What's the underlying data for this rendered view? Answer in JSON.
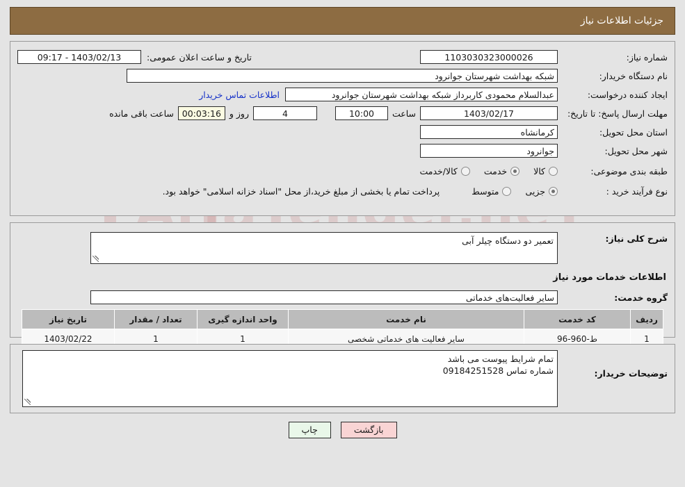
{
  "header": {
    "title": "جزئیات اطلاعات نیاز"
  },
  "watermark": {
    "line1": "AriaTender.neT",
    "line2": ""
  },
  "top_section": {
    "need_number": {
      "label": "شماره نیاز:",
      "value": "1103030323000026"
    },
    "public_announce": {
      "label": "تاریخ و ساعت اعلان عمومی:",
      "value": "1403/02/13 - 09:17"
    },
    "buyer_org": {
      "label": "نام دستگاه خریدار:",
      "value": "شبکه بهداشت شهرستان جوانرود"
    },
    "request_creator": {
      "label": "ایجاد کننده درخواست:",
      "value": "عبدالسلام محمودی کاربرداز شبکه بهداشت شهرستان جوانرود"
    },
    "contact_link": "اطلاعات تماس خریدار",
    "deadline": {
      "label": "مهلت ارسال پاسخ: تا تاریخ:",
      "date": "1403/02/17",
      "time_label": "ساعت",
      "time": "10:00",
      "days": "4",
      "days_label": "روز و",
      "countdown": "00:03:16",
      "countdown_label": "ساعت باقی مانده"
    },
    "province": {
      "label": "استان محل تحویل:",
      "value": "کرمانشاه"
    },
    "city": {
      "label": "شهر محل تحویل:",
      "value": "جوانرود"
    },
    "category": {
      "label": "طبقه بندی موضوعی:",
      "options": [
        {
          "label": "کالا",
          "selected": false
        },
        {
          "label": "خدمت",
          "selected": true
        },
        {
          "label": "کالا/خدمت",
          "selected": false
        }
      ]
    },
    "purchase_type": {
      "label": "نوع فرآیند خرید :",
      "options": [
        {
          "label": "جزیی",
          "selected": true
        },
        {
          "label": "متوسط",
          "selected": false
        }
      ],
      "note": "پرداخت تمام یا بخشی از مبلغ خرید،از محل \"اسناد خزانه اسلامی\" خواهد بود."
    }
  },
  "middle_section": {
    "general_desc": {
      "label": "شرح کلی نیاز:",
      "value": "تعمیر دو دستگاه چیلر آبی"
    },
    "services_heading": "اطلاعات خدمات مورد نیاز",
    "service_group": {
      "label": "گروه خدمت:",
      "value": "سایر فعالیت‌های خدماتی"
    },
    "table": {
      "columns": [
        "ردیف",
        "کد خدمت",
        "نام خدمت",
        "واحد اندازه گیری",
        "تعداد / مقدار",
        "تاریخ نیاز"
      ],
      "rows": [
        {
          "radif": "1",
          "code": "ط-960-96",
          "name": "سایر فعالیت های خدماتی شخصی",
          "unit": "1",
          "qty": "1",
          "date": "1403/02/22"
        }
      ]
    }
  },
  "bottom_section": {
    "buyer_notes": {
      "label": "توضیحات خریدار:",
      "line1": "تمام شرایط پیوست می باشد",
      "line2": "شماره تماس 09184251528"
    }
  },
  "footer": {
    "back_label": "بازگشت",
    "print_label": "چاپ"
  },
  "colors": {
    "header_bg": "#8d6c42",
    "page_bg": "#e4e4e4",
    "link": "#1531c8",
    "back_btn": "#f9d4d4",
    "print_btn": "#e9f7e9",
    "table_header": "#bcbcbc",
    "countdown_bg": "#fbfbe2"
  }
}
